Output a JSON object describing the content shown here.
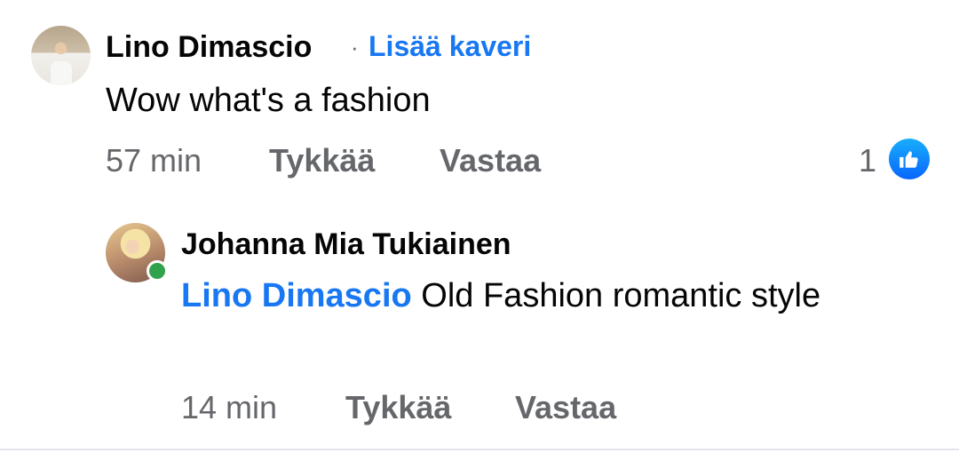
{
  "comment": {
    "author": "Lino Dimascio",
    "separator": "·",
    "add_friend": "Lisää kaveri",
    "text": "Wow what's a fashion",
    "time": "57 min",
    "like_label": "Tykkää",
    "reply_label": "Vastaa",
    "reaction_count": "1",
    "reaction_icon": "thumbs-up-icon"
  },
  "reply": {
    "author": "Johanna Mia Tukiainen",
    "mention": "Lino Dimascio",
    "text": " Old Fashion romantic style",
    "time": "14 min",
    "like_label": "Tykkää",
    "reply_label": "Vastaa",
    "online": true
  },
  "colors": {
    "accent": "#1877f2",
    "secondary_text": "#65676b",
    "online": "#31a24c"
  }
}
